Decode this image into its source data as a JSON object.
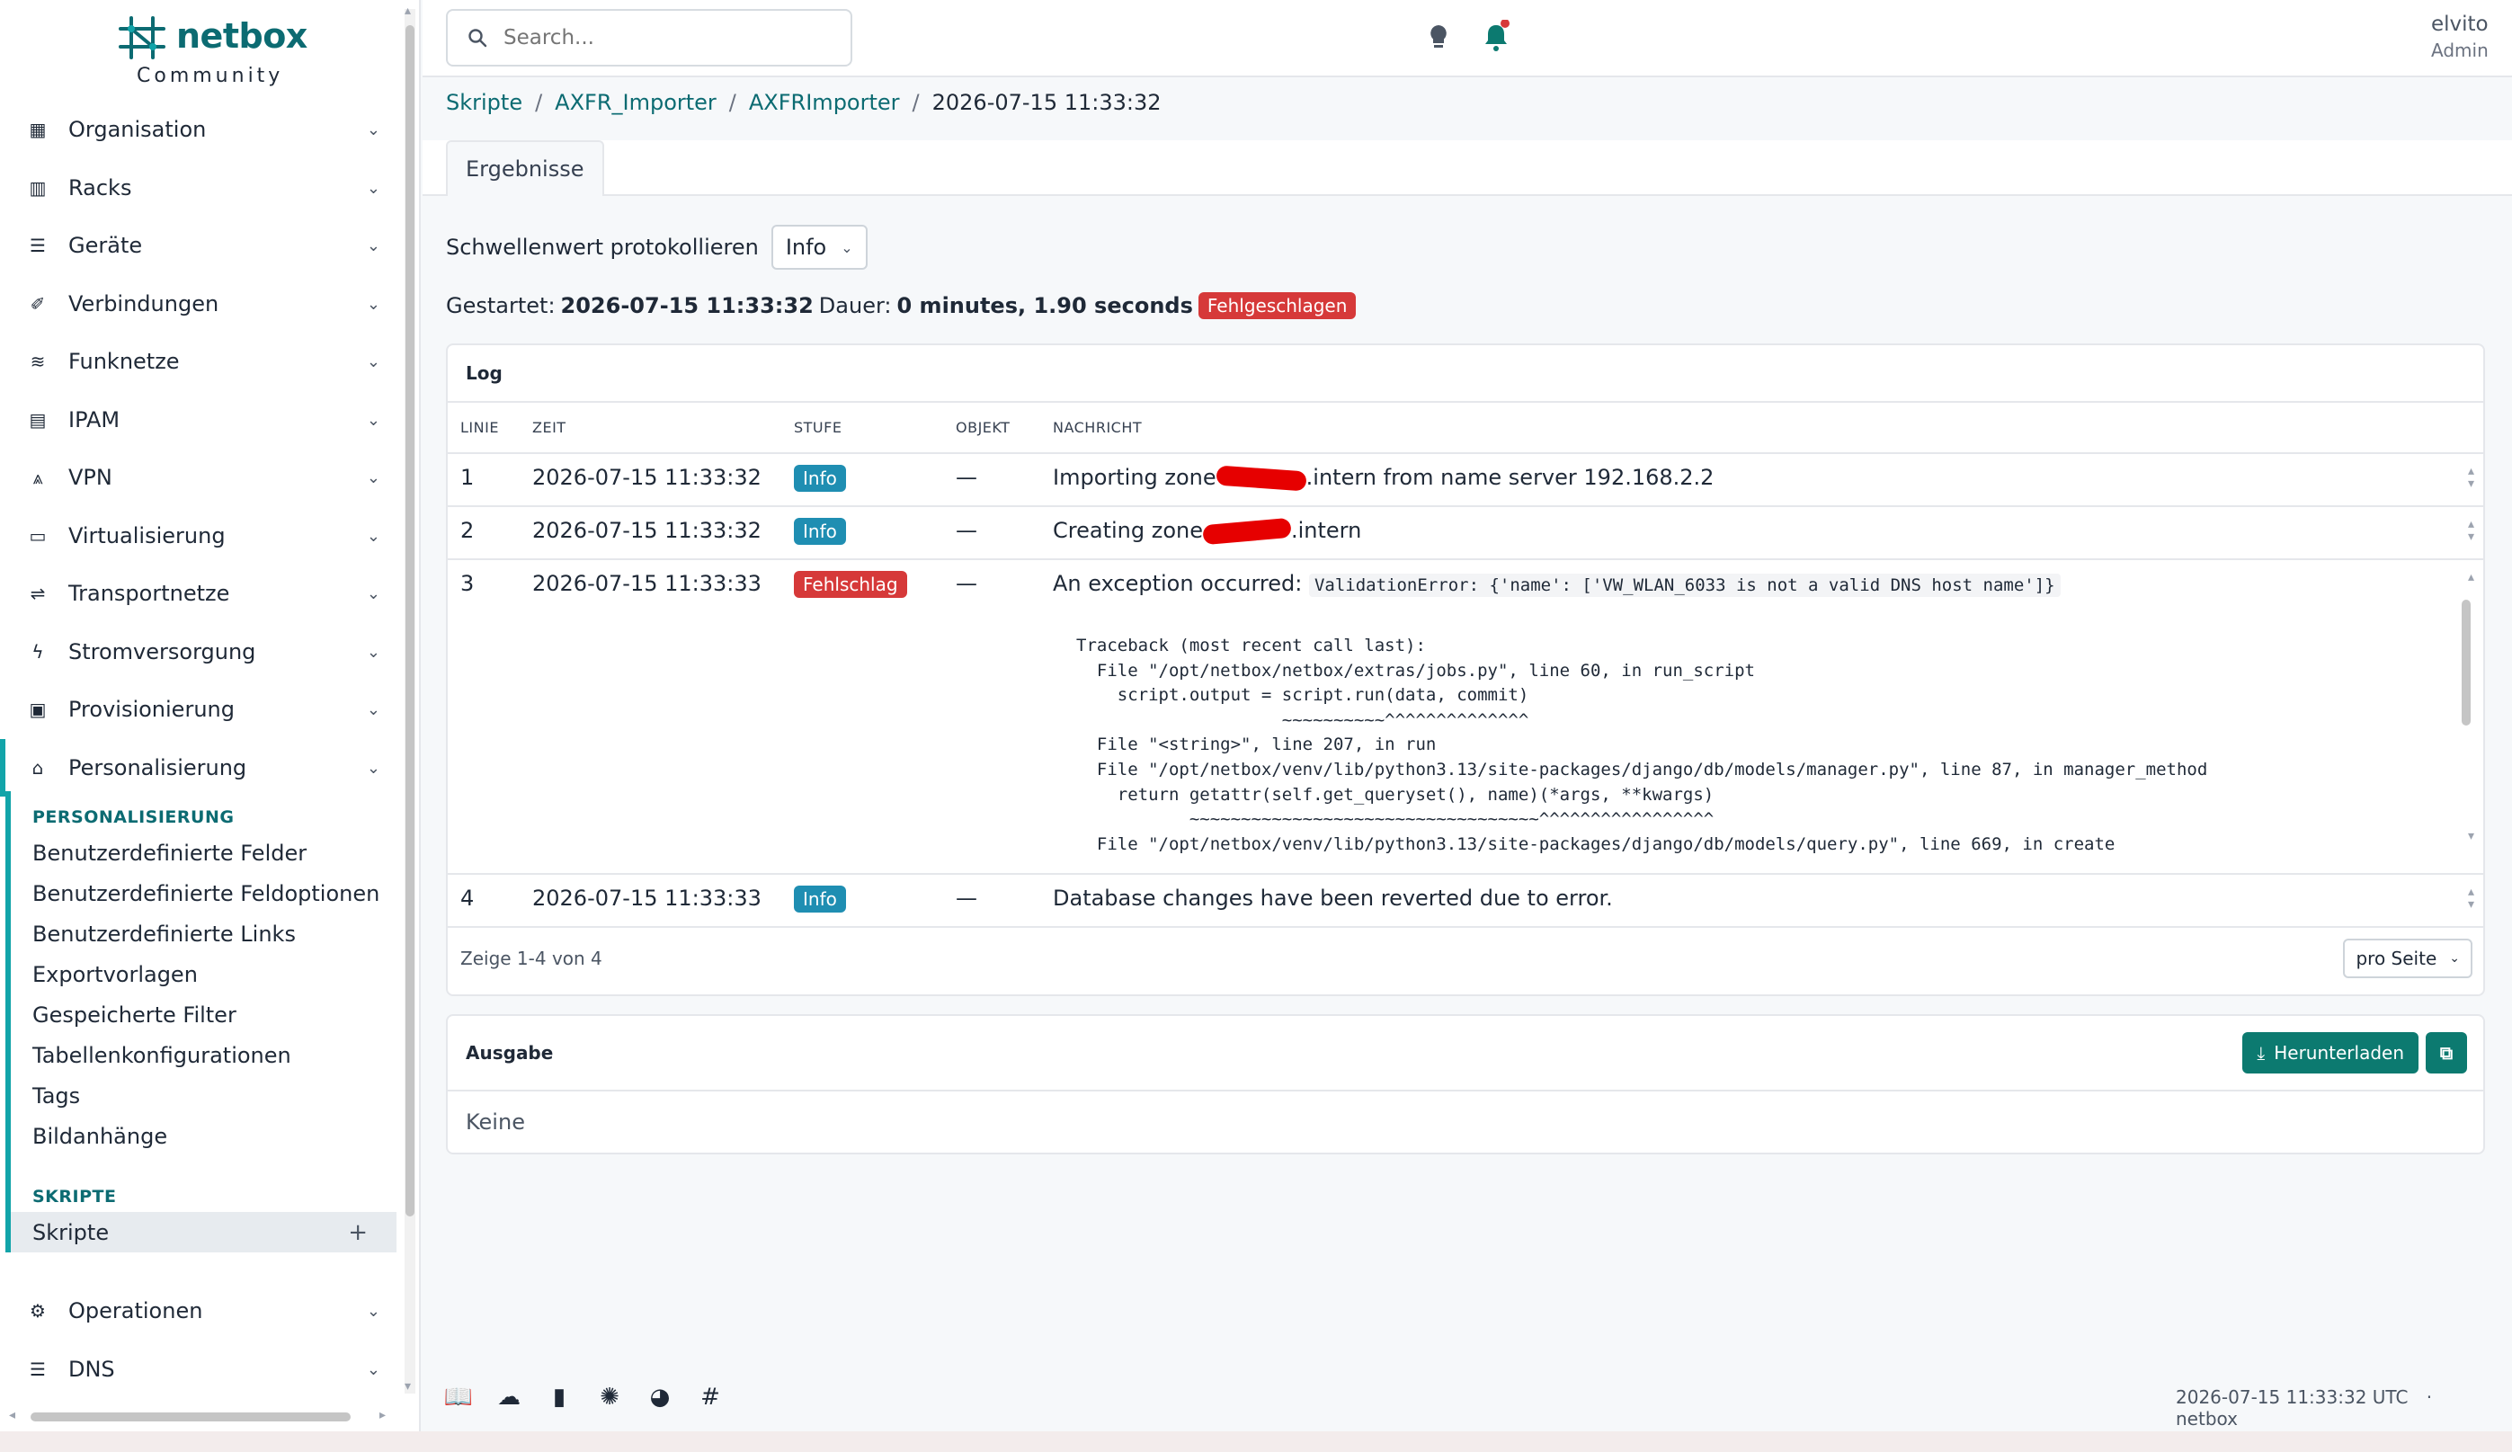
{
  "brand": {
    "name": "netbox",
    "sub": "Community"
  },
  "sidebar": {
    "items": [
      {
        "label": "Organisation",
        "icon": "building-icon"
      },
      {
        "label": "Racks",
        "icon": "rack-icon"
      },
      {
        "label": "Geräte",
        "icon": "server-icon"
      },
      {
        "label": "Verbindungen",
        "icon": "cable-icon"
      },
      {
        "label": "Funknetze",
        "icon": "wifi-icon"
      },
      {
        "label": "IPAM",
        "icon": "counter-icon"
      },
      {
        "label": "VPN",
        "icon": "tunnel-icon"
      },
      {
        "label": "Virtualisierung",
        "icon": "monitor-icon"
      },
      {
        "label": "Transportnetze",
        "icon": "transit-icon"
      },
      {
        "label": "Stromversorgung",
        "icon": "flash-icon"
      },
      {
        "label": "Provisionierung",
        "icon": "file-icon"
      },
      {
        "label": "Personalisierung",
        "icon": "toolbox-icon"
      }
    ],
    "section_personalisierung": "PERSONALISIERUNG",
    "personalisierung_links": [
      "Benutzerdefinierte Felder",
      "Benutzerdefinierte Feldoptionen",
      "Benutzerdefinierte Links",
      "Exportvorlagen",
      "Gespeicherte Filter",
      "Tabellenkonfigurationen",
      "Tags",
      "Bildanhänge"
    ],
    "section_skripte": "SKRIPTE",
    "skripte_link": "Skripte",
    "bottom_items": [
      {
        "label": "Operationen",
        "icon": "cogs-icon"
      },
      {
        "label": "DNS",
        "icon": "dns-icon"
      }
    ]
  },
  "search": {
    "placeholder": "Search..."
  },
  "user": {
    "name": "elvito",
    "role": "Admin"
  },
  "breadcrumb": {
    "items": [
      "Skripte",
      "AXFR_Importer",
      "AXFRImporter"
    ],
    "current": "2026-07-15 11:33:32"
  },
  "tabs": {
    "results": "Ergebnisse"
  },
  "threshold": {
    "label": "Schwellenwert protokollieren",
    "value": "Info"
  },
  "run": {
    "started_label": "Gestartet:",
    "started_value": "2026-07-15 11:33:32",
    "duration_label": "Dauer:",
    "duration_value": "0 minutes, 1.90 seconds",
    "status": "Fehlgeschlagen"
  },
  "log": {
    "title": "Log",
    "columns": [
      "LINIE",
      "ZEIT",
      "STUFE",
      "OBJEKT",
      "NACHRICHT"
    ],
    "rows": [
      {
        "line": "1",
        "time": "2026-07-15 11:33:32",
        "level": "Info",
        "object": "—",
        "msg_a": "Importing zone",
        "msg_b": ".intern from name server 192.168.2.2"
      },
      {
        "line": "2",
        "time": "2026-07-15 11:33:32",
        "level": "Info",
        "object": "—",
        "msg_a": "Creating zone",
        "msg_b": ".intern"
      },
      {
        "line": "3",
        "time": "2026-07-15 11:33:33",
        "level": "Fehlschlag",
        "object": "—",
        "msg_a": "An exception occurred:",
        "code": "ValidationError: {'name': ['VW_WLAN_6033 is not a valid DNS host name']}",
        "trace": "Traceback (most recent call last):\n  File \"/opt/netbox/netbox/extras/jobs.py\", line 60, in run_script\n    script.output = script.run(data, commit)\n                    ~~~~~~~~~~^^^^^^^^^^^^^^\n  File \"<string>\", line 207, in run\n  File \"/opt/netbox/venv/lib/python3.13/site-packages/django/db/models/manager.py\", line 87, in manager_method\n    return getattr(self.get_queryset(), name)(*args, **kwargs)\n           ~~~~~~~~~~~~~~~~~~~~~~~~~~~~~~~~~~^^^^^^^^^^^^^^^^^\n  File \"/opt/netbox/venv/lib/python3.13/site-packages/django/db/models/query.py\", line 669, in create"
      },
      {
        "line": "4",
        "time": "2026-07-15 11:33:33",
        "level": "Info",
        "object": "—",
        "msg_a": "Database changes have been reverted due to error."
      }
    ],
    "footer": "Zeige 1-4 von 4",
    "per_page": "pro Seite"
  },
  "output": {
    "title": "Ausgabe",
    "download": "Herunterladen",
    "empty": "Keine"
  },
  "footer": {
    "timestamp": "2026-07-15 11:33:32 UTC",
    "dot": "·",
    "brand": "netbox"
  },
  "colors": {
    "accent": "#0c6b72",
    "teal": "#12a4a9",
    "danger": "#d63939",
    "info": "#1f8eb2",
    "button": "#0c7a70"
  }
}
